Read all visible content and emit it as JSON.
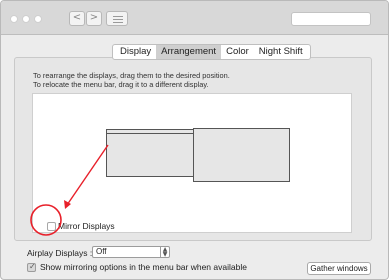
{
  "window": {
    "nav_back": "<",
    "nav_forward": ">"
  },
  "tabs": [
    {
      "label": "Display",
      "active": false
    },
    {
      "label": "Arrangement",
      "active": true
    },
    {
      "label": "Color",
      "active": false
    },
    {
      "label": "Night Shift",
      "active": false
    }
  ],
  "arrangement": {
    "instruction_line1": "To rearrange the displays, drag them to the desired position.",
    "instruction_line2": "To relocate the menu bar, drag it to a different display.",
    "mirror_label": "Mirror Displays",
    "mirror_checked": false
  },
  "airplay": {
    "label": "Airplay Displays :",
    "value": "Off",
    "stepper": "⇕"
  },
  "mirroring_option": {
    "label": "Show mirroring options in the menu bar when available",
    "checked": true,
    "check_glyph": "✓"
  },
  "gather_label": "Gather windows",
  "colors": {
    "annotation_red": "#e8202a",
    "active_tab": "#cfcfcf",
    "window_bg": "#ececec"
  }
}
